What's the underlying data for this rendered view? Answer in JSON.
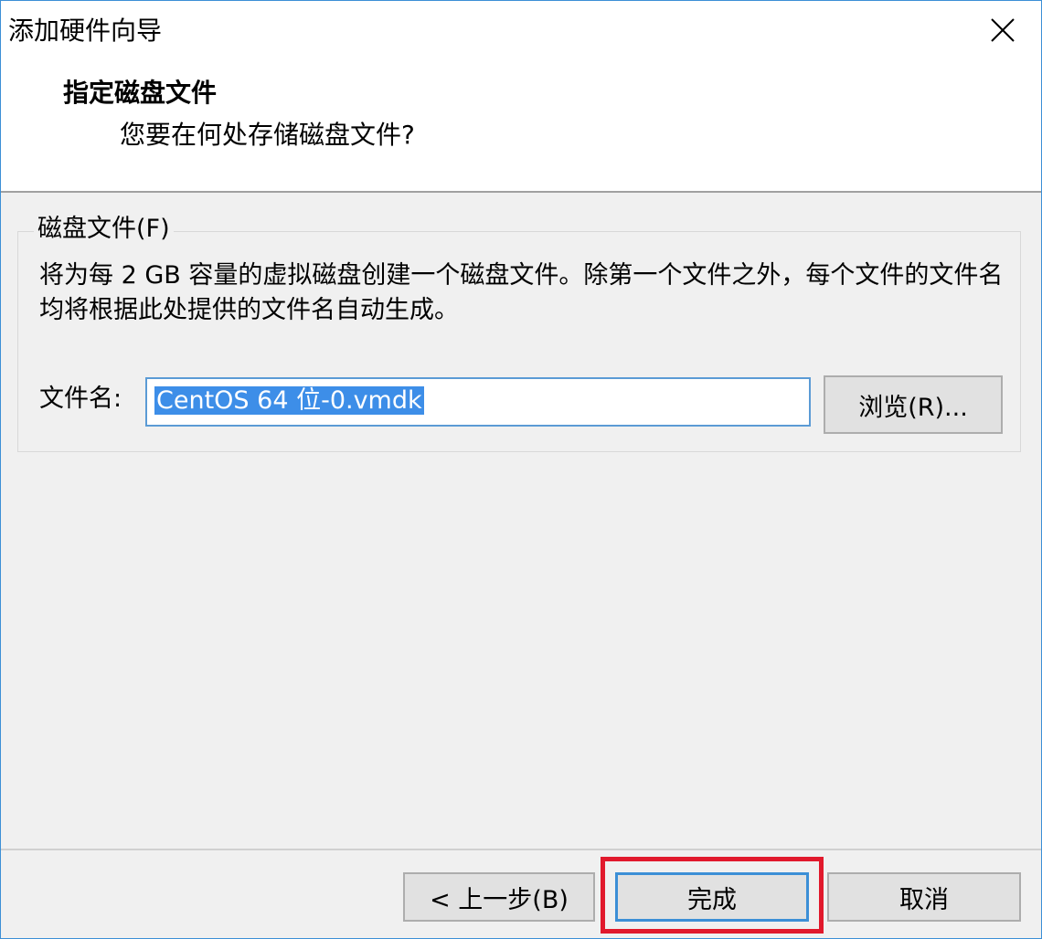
{
  "window": {
    "title": "添加硬件向导",
    "close_icon": "close-icon"
  },
  "header": {
    "title": "指定磁盘文件",
    "subtitle": "您要在何处存储磁盘文件?"
  },
  "disk_group": {
    "legend": "磁盘文件(F)",
    "description": "将为每 2 GB 容量的虚拟磁盘创建一个磁盘文件。除第一个文件之外，每个文件的文件名均将根据此处提供的文件名自动生成。",
    "filename_label": "文件名:",
    "filename_value": "CentOS 64 位-0.vmdk",
    "browse_label": "浏览(R)..."
  },
  "footer": {
    "back_label": "< 上一步(B)",
    "finish_label": "完成",
    "cancel_label": "取消"
  },
  "colors": {
    "accent": "#3c8fd6",
    "highlight": "#e1192c",
    "selection": "#3d8ee8"
  }
}
